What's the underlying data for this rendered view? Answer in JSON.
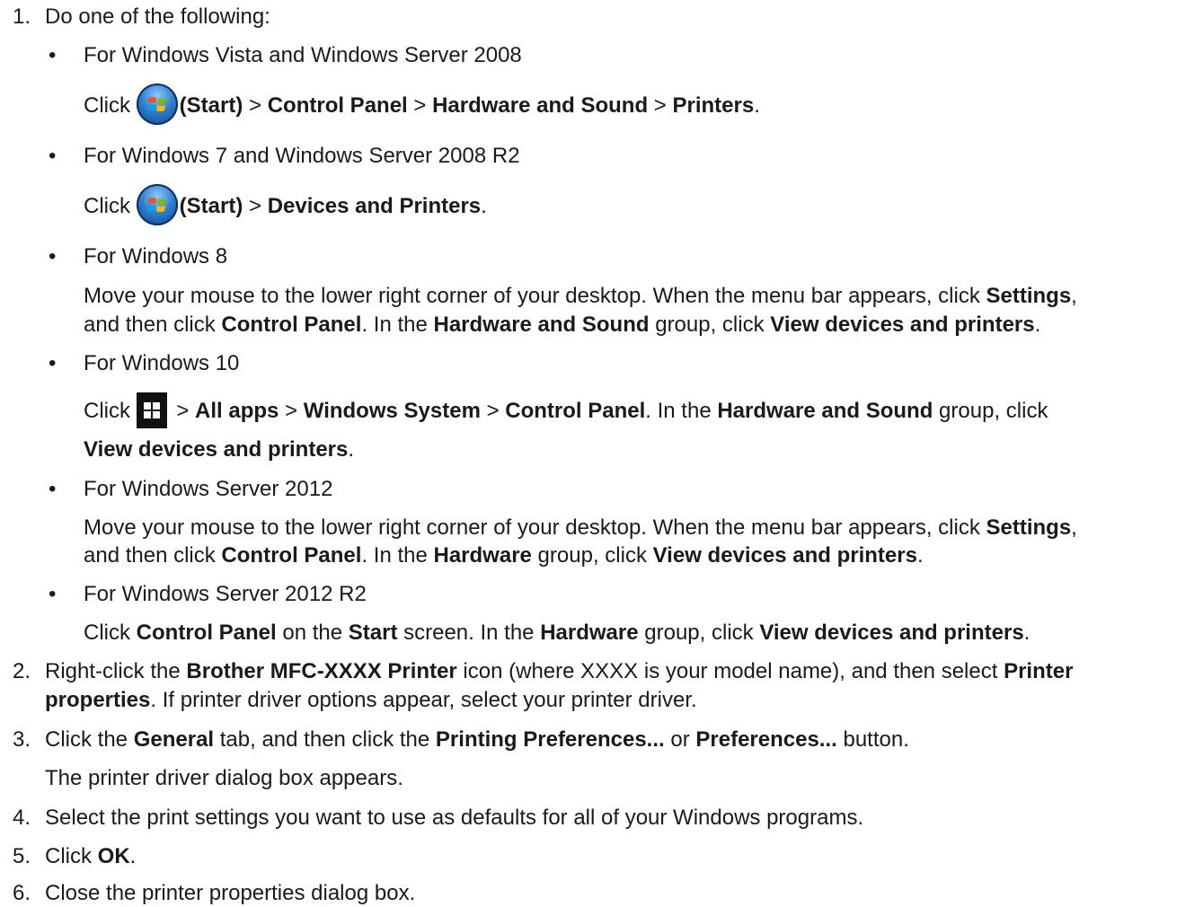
{
  "steps": {
    "s1": {
      "num": "1.",
      "text": "Do one of the following:"
    },
    "vista": {
      "bullet": "•",
      "heading": "For Windows Vista and Windows Server 2008",
      "click": "Click ",
      "start": "(Start)",
      "sep": " > ",
      "cp": "Control Panel",
      "hs": "Hardware and Sound",
      "printers": "Printers",
      "end": "."
    },
    "win7": {
      "bullet": "•",
      "heading": "For Windows 7 and Windows Server 2008 R2",
      "click": "Click ",
      "start": "(Start)",
      "sep": " > ",
      "dp": "Devices and Printers",
      "end": "."
    },
    "win8": {
      "bullet": "•",
      "heading": "For Windows 8",
      "l1a": "Move your mouse to the lower right corner of your desktop. When the menu bar appears, click ",
      "settings": "Settings",
      "l1b": ",",
      "l2a": "and then click ",
      "cp": "Control Panel",
      "l2b": ". In the ",
      "hs": "Hardware and Sound",
      "l2c": " group, click ",
      "vdp": "View devices and printers",
      "end": "."
    },
    "win10": {
      "bullet": "•",
      "heading": "For Windows 10",
      "click": "Click ",
      "sep": " > ",
      "allapps": "All apps",
      "winsys": "Windows System",
      "cp": "Control Panel",
      "l1b": ". In the ",
      "hs": "Hardware and Sound",
      "l1c": " group, click",
      "vdp": "View devices and printers",
      "end": "."
    },
    "ws2012": {
      "bullet": "•",
      "heading": "For Windows Server 2012",
      "l1a": "Move your mouse to the lower right corner of your desktop. When the menu bar appears, click ",
      "settings": "Settings",
      "l1b": ",",
      "l2a": "and then click ",
      "cp": "Control Panel",
      "l2b": ". In the ",
      "hw": "Hardware",
      "l2c": " group, click ",
      "vdp": "View devices and printers",
      "end": "."
    },
    "ws2012r2": {
      "bullet": "•",
      "heading": "For Windows Server 2012 R2",
      "click": "Click ",
      "cp": "Control Panel",
      "on": " on the ",
      "start": "Start",
      "screen": " screen. In the ",
      "hw": "Hardware",
      "group": " group, click ",
      "vdp": "View devices and printers",
      "end": "."
    },
    "s2": {
      "num": "2.",
      "a": "Right-click the ",
      "printer": "Brother MFC-XXXX Printer",
      "b": " icon (where XXXX is your model name), and then select ",
      "pp1": "Printer",
      "pp2": "properties",
      "c": ". If printer driver options appear, select your printer driver."
    },
    "s3": {
      "num": "3.",
      "a": "Click the ",
      "general": "General",
      "b": " tab, and then click the ",
      "pref1": "Printing Preferences...",
      "or": " or ",
      "pref2": "Preferences...",
      "c": " button.",
      "sub": "The printer driver dialog box appears."
    },
    "s4": {
      "num": "4.",
      "text": "Select the print settings you want to use as defaults for all of your Windows programs."
    },
    "s5": {
      "num": "5.",
      "a": "Click ",
      "ok": "OK",
      "end": "."
    },
    "s6": {
      "num": "6.",
      "text": "Close the printer properties dialog box."
    }
  },
  "icons": {
    "start_orb": "windows-start-orb-icon",
    "win10_start": "windows-10-start-icon"
  },
  "colors": {
    "text": "#1a1a1a",
    "orb": "#2f7fd0",
    "win10_tile": "#111111"
  }
}
